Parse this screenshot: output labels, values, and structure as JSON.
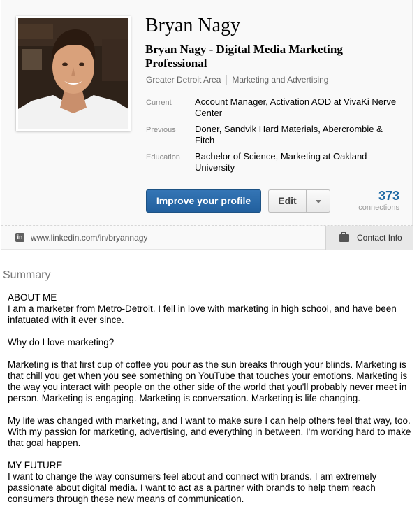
{
  "profile": {
    "name": "Bryan Nagy",
    "headline": "Bryan Nagy - Digital Media Marketing Professional",
    "location": "Greater Detroit Area",
    "industry": "Marketing and Advertising",
    "facts": [
      {
        "label": "Current",
        "value": "Account Manager, Activation AOD at VivaKi Nerve Center"
      },
      {
        "label": "Previous",
        "value": "Doner, Sandvik Hard Materials, Abercrombie & Fitch"
      },
      {
        "label": "Education",
        "value": "Bachelor of Science, Marketing at Oakland University"
      }
    ]
  },
  "actions": {
    "improve_label": "Improve your profile",
    "edit_label": "Edit"
  },
  "connections": {
    "count": "373",
    "label": "connections"
  },
  "url_bar": {
    "linkedin_icon_text": "in",
    "url": "www.linkedin.com/in/bryannagy",
    "contact_label": "Contact Info"
  },
  "summary": {
    "title": "Summary",
    "paragraphs": [
      "ABOUT ME\nI am a marketer from Metro-Detroit. I fell in love with marketing in high school, and have been infatuated with it ever since.",
      "Why do I love marketing?",
      "Marketing is that first cup of coffee you pour as the sun breaks through your blinds. Marketing is that chill you get when you see something on YouTube that touches your emotions. Marketing is the way you interact with people on the other side of the world that you'll probably never meet in person. Marketing is engaging. Marketing is conversation. Marketing is life changing.",
      "My life was changed with marketing, and I want to make sure I can help others feel that way, too. With my passion for marketing, advertising, and everything in between, I'm working hard to make that goal happen.",
      "MY FUTURE\nI want to change the way consumers feel about and connect with brands. I am extremely passionate about digital media. I want to act as a partner with brands to help them reach consumers through these new means of communication."
    ]
  },
  "colors": {
    "primary_button": "#22609e",
    "connections_count": "#1f6aa5",
    "card_background": "#f9f9f9"
  },
  "icons": {
    "linkedin": "linkedin-icon",
    "contact": "contact-card-icon",
    "dropdown": "chevron-down-icon"
  }
}
